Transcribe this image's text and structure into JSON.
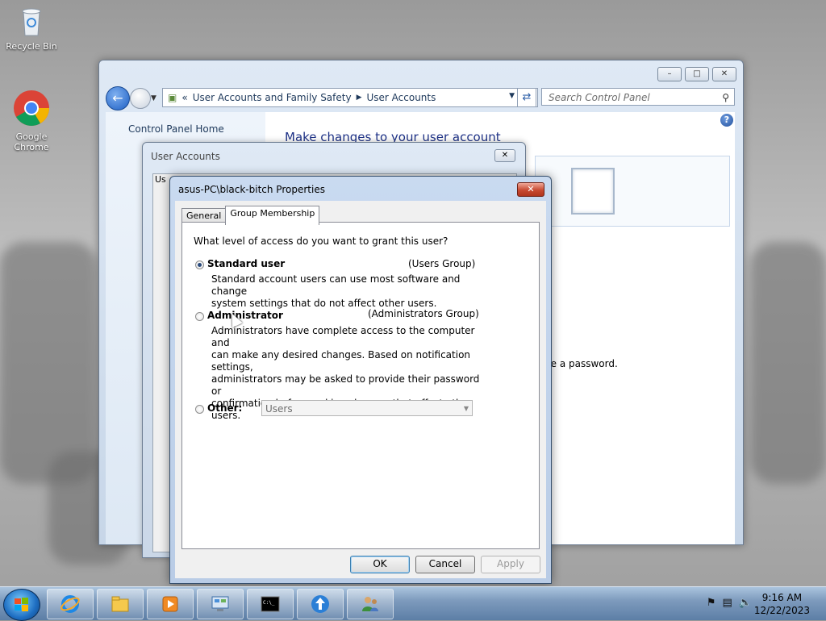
{
  "desktop": {
    "icons": [
      {
        "label": "Recycle Bin"
      },
      {
        "label": "Google Chrome"
      }
    ]
  },
  "control_panel": {
    "breadcrumb": {
      "prefix": "«",
      "parts": [
        "User Accounts and Family Safety",
        "User Accounts"
      ]
    },
    "search_placeholder": "Search Control Panel",
    "home_link": "Control Panel Home",
    "heading": "Make changes to your user account",
    "partial_text": "ge a password."
  },
  "user_accounts_dialog": {
    "title": "User Accounts",
    "tab_fragment": "Us"
  },
  "properties_dialog": {
    "title": "asus-PC\\black-bitch Properties",
    "tabs": [
      {
        "label": "General",
        "active": false
      },
      {
        "label": "Group Membership",
        "active": true
      }
    ],
    "question": "What level of access do you want to grant this user?",
    "options": {
      "standard": {
        "label": "Standard user",
        "group": "(Users Group)",
        "desc_lines": [
          "Standard account users can use most software and change",
          "system settings that do not affect other users."
        ],
        "checked": true
      },
      "administrator": {
        "label": "Administrator",
        "group": "(Administrators Group)",
        "desc_lines": [
          "Administrators have complete access to the computer and",
          "can make any desired changes. Based on notification settings,",
          "administrators may be asked to provide their password or",
          "confirmation before making changes that affect other users."
        ],
        "checked": false
      },
      "other": {
        "label": "Other:",
        "select_value": "Users",
        "checked": false
      }
    },
    "buttons": {
      "ok": "OK",
      "cancel": "Cancel",
      "apply": "Apply"
    }
  },
  "taskbar": {
    "pinned": [
      "internet-explorer-icon",
      "explorer-icon",
      "media-player-icon",
      "control-panel-icon",
      "cmd-icon",
      "update-icon",
      "user-accounts-icon"
    ],
    "clock": {
      "time": "9:16 AM",
      "date": "12/22/2023"
    }
  }
}
